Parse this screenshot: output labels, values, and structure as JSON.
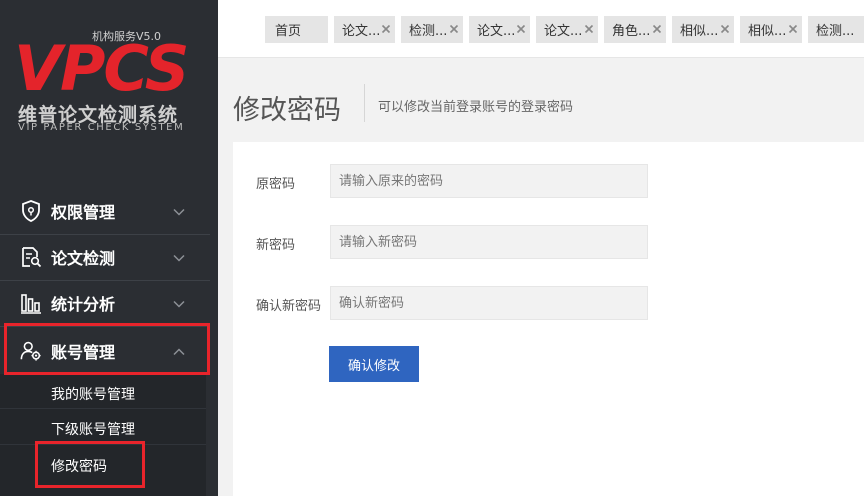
{
  "logo": {
    "version": "机构服务V5.0",
    "main": "VPCS",
    "name_cn": "维普论文检测系统",
    "name_en": "VIP PAPER CHECK SYSTEM",
    "brand_color": "#e4242b"
  },
  "sidebar": {
    "items": [
      {
        "label": "权限管理",
        "icon": "shield-icon",
        "expanded": false
      },
      {
        "label": "论文检测",
        "icon": "document-search-icon",
        "expanded": false
      },
      {
        "label": "统计分析",
        "icon": "bar-chart-icon",
        "expanded": false
      },
      {
        "label": "账号管理",
        "icon": "user-gear-icon",
        "expanded": true
      }
    ],
    "sub_items": [
      {
        "label": "我的账号管理"
      },
      {
        "label": "下级账号管理"
      },
      {
        "label": "修改密码",
        "active": true
      }
    ]
  },
  "tabs": [
    {
      "label": "首页",
      "closable": false
    },
    {
      "label": "论文...",
      "closable": true
    },
    {
      "label": "检测...",
      "closable": true
    },
    {
      "label": "论文...",
      "closable": true
    },
    {
      "label": "论文...",
      "closable": true
    },
    {
      "label": "角色...",
      "closable": true
    },
    {
      "label": "相似...",
      "closable": true
    },
    {
      "label": "相似...",
      "closable": true
    },
    {
      "label": "检测...",
      "closable": true
    }
  ],
  "page": {
    "title": "修改密码",
    "description": "可以修改当前登录账号的登录密码"
  },
  "form": {
    "old_password": {
      "label": "原密码",
      "placeholder": "请输入原来的密码"
    },
    "new_password": {
      "label": "新密码",
      "placeholder": "请输入新密码"
    },
    "confirm_password": {
      "label": "确认新密码",
      "placeholder": "确认新密码"
    },
    "submit_label": "确认修改",
    "submit_color": "#2f65c0"
  },
  "highlight_color": "#e8242b"
}
